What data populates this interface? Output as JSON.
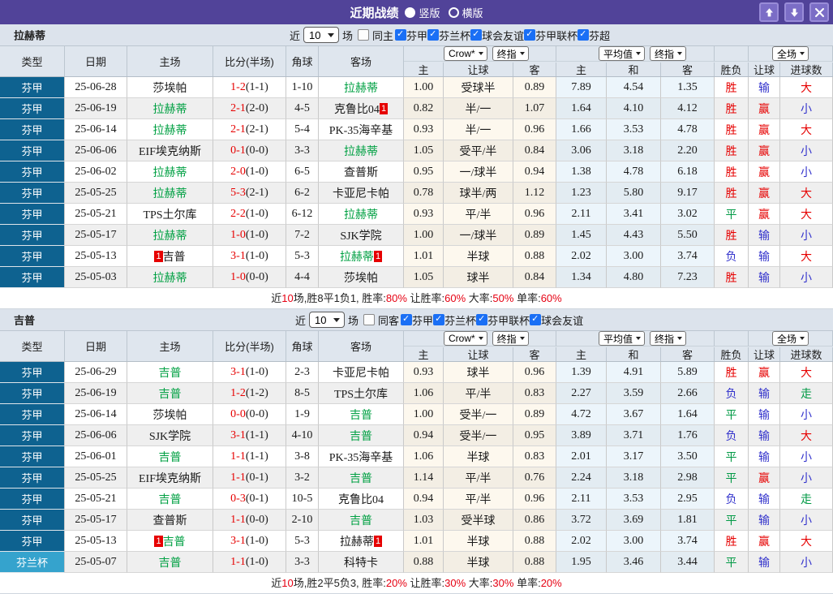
{
  "titlebar": {
    "title": "近期战绩",
    "radios": [
      {
        "label": "竖版",
        "selected": true
      },
      {
        "label": "横版",
        "selected": false
      }
    ],
    "buttons": [
      {
        "name": "scroll-up-button",
        "icon": "arrow-up-icon"
      },
      {
        "name": "scroll-down-button",
        "icon": "arrow-down-icon"
      },
      {
        "name": "close-button",
        "icon": "close-icon"
      }
    ],
    "colors": {
      "bar": "#514399",
      "button": "#7b6dc6"
    }
  },
  "table_header": {
    "static_cols": [
      "类型",
      "日期",
      "主场",
      "比分(半场)",
      "角球",
      "客场"
    ],
    "groups": [
      {
        "selects": [
          "Crow*",
          "终指"
        ]
      },
      {
        "selects": [
          "平均值",
          "终指"
        ]
      },
      {
        "selects": [
          "全场"
        ]
      }
    ],
    "sub_cols": [
      "主",
      "让球",
      "客",
      "主",
      "和",
      "客",
      "胜负",
      "让球",
      "进球数"
    ]
  },
  "colors": {
    "league_cell": "#0e6290",
    "cup_cell": "#35a3cd",
    "focus_team": "#00a043",
    "score_red": "#e60000",
    "win_red": "#e60000",
    "lose_blue": "#3333cc",
    "draw_green": "#009944"
  },
  "sections": [
    {
      "team": "拉赫蒂",
      "filter": {
        "near": "近",
        "count": "10",
        "games": "场",
        "same": {
          "label": "同主",
          "checked": false
        },
        "leagues": [
          {
            "label": "芬甲",
            "checked": true
          },
          {
            "label": "芬兰杯",
            "checked": true
          },
          {
            "label": "球会友谊",
            "checked": true
          },
          {
            "label": "芬甲联杯",
            "checked": true
          },
          {
            "label": "芬超",
            "checked": true
          }
        ]
      },
      "rows": [
        {
          "league": "芬甲",
          "cup": false,
          "date": "25-06-28",
          "home": {
            "name": "莎埃帕",
            "focus": false
          },
          "score": "1-2",
          "half": "(1-1)",
          "corners": "1-10",
          "away": {
            "name": "拉赫蒂",
            "focus": true
          },
          "ah": [
            "1.00",
            "受球半",
            "0.89"
          ],
          "eu": [
            "7.89",
            "4.54",
            "1.35"
          ],
          "outcome": {
            "text": "胜",
            "c": "red"
          },
          "handicap": {
            "text": "输",
            "c": "blue"
          },
          "goals": {
            "text": "大",
            "c": "red"
          }
        },
        {
          "league": "芬甲",
          "cup": false,
          "date": "25-06-19",
          "home": {
            "name": "拉赫蒂",
            "focus": true
          },
          "score": "2-1",
          "half": "(2-0)",
          "corners": "4-5",
          "away": {
            "name": "克鲁比04",
            "focus": false,
            "badge": "1",
            "badge_pos": "after"
          },
          "ah": [
            "0.82",
            "半/一",
            "1.07"
          ],
          "eu": [
            "1.64",
            "4.10",
            "4.12"
          ],
          "outcome": {
            "text": "胜",
            "c": "red"
          },
          "handicap": {
            "text": "赢",
            "c": "red"
          },
          "goals": {
            "text": "小",
            "c": "blue"
          }
        },
        {
          "league": "芬甲",
          "cup": false,
          "date": "25-06-14",
          "home": {
            "name": "拉赫蒂",
            "focus": true
          },
          "score": "2-1",
          "half": "(2-1)",
          "corners": "5-4",
          "away": {
            "name": "PK-35海辛基",
            "focus": false
          },
          "ah": [
            "0.93",
            "半/一",
            "0.96"
          ],
          "eu": [
            "1.66",
            "3.53",
            "4.78"
          ],
          "outcome": {
            "text": "胜",
            "c": "red"
          },
          "handicap": {
            "text": "赢",
            "c": "red"
          },
          "goals": {
            "text": "大",
            "c": "red"
          }
        },
        {
          "league": "芬甲",
          "cup": false,
          "date": "25-06-06",
          "home": {
            "name": "EIF埃克纳斯",
            "focus": false
          },
          "score": "0-1",
          "half": "(0-0)",
          "corners": "3-3",
          "away": {
            "name": "拉赫蒂",
            "focus": true
          },
          "ah": [
            "1.05",
            "受平/半",
            "0.84"
          ],
          "eu": [
            "3.06",
            "3.18",
            "2.20"
          ],
          "outcome": {
            "text": "胜",
            "c": "red"
          },
          "handicap": {
            "text": "赢",
            "c": "red"
          },
          "goals": {
            "text": "小",
            "c": "blue"
          }
        },
        {
          "league": "芬甲",
          "cup": false,
          "date": "25-06-02",
          "home": {
            "name": "拉赫蒂",
            "focus": true
          },
          "score": "2-0",
          "half": "(1-0)",
          "corners": "6-5",
          "away": {
            "name": "查普斯",
            "focus": false
          },
          "ah": [
            "0.95",
            "一/球半",
            "0.94"
          ],
          "eu": [
            "1.38",
            "4.78",
            "6.18"
          ],
          "outcome": {
            "text": "胜",
            "c": "red"
          },
          "handicap": {
            "text": "赢",
            "c": "red"
          },
          "goals": {
            "text": "小",
            "c": "blue"
          }
        },
        {
          "league": "芬甲",
          "cup": false,
          "date": "25-05-25",
          "home": {
            "name": "拉赫蒂",
            "focus": true
          },
          "score": "5-3",
          "half": "(2-1)",
          "corners": "6-2",
          "away": {
            "name": "卡亚尼卡帕",
            "focus": false
          },
          "ah": [
            "0.78",
            "球半/两",
            "1.12"
          ],
          "eu": [
            "1.23",
            "5.80",
            "9.17"
          ],
          "outcome": {
            "text": "胜",
            "c": "red"
          },
          "handicap": {
            "text": "赢",
            "c": "red"
          },
          "goals": {
            "text": "大",
            "c": "red"
          }
        },
        {
          "league": "芬甲",
          "cup": false,
          "date": "25-05-21",
          "home": {
            "name": "TPS土尔库",
            "focus": false
          },
          "score": "2-2",
          "half": "(1-0)",
          "corners": "6-12",
          "away": {
            "name": "拉赫蒂",
            "focus": true
          },
          "ah": [
            "0.93",
            "平/半",
            "0.96"
          ],
          "eu": [
            "2.11",
            "3.41",
            "3.02"
          ],
          "outcome": {
            "text": "平",
            "c": "green"
          },
          "handicap": {
            "text": "赢",
            "c": "red"
          },
          "goals": {
            "text": "大",
            "c": "red"
          }
        },
        {
          "league": "芬甲",
          "cup": false,
          "date": "25-05-17",
          "home": {
            "name": "拉赫蒂",
            "focus": true
          },
          "score": "1-0",
          "half": "(1-0)",
          "corners": "7-2",
          "away": {
            "name": "SJK学院",
            "focus": false
          },
          "ah": [
            "1.00",
            "一/球半",
            "0.89"
          ],
          "eu": [
            "1.45",
            "4.43",
            "5.50"
          ],
          "outcome": {
            "text": "胜",
            "c": "red"
          },
          "handicap": {
            "text": "输",
            "c": "blue"
          },
          "goals": {
            "text": "小",
            "c": "blue"
          }
        },
        {
          "league": "芬甲",
          "cup": false,
          "date": "25-05-13",
          "home": {
            "name": "吉普",
            "focus": false,
            "badge": "1",
            "badge_pos": "before"
          },
          "score": "3-1",
          "half": "(1-0)",
          "corners": "5-3",
          "away": {
            "name": "拉赫蒂",
            "focus": true,
            "badge": "1",
            "badge_pos": "after"
          },
          "ah": [
            "1.01",
            "半球",
            "0.88"
          ],
          "eu": [
            "2.02",
            "3.00",
            "3.74"
          ],
          "outcome": {
            "text": "负",
            "c": "blue"
          },
          "handicap": {
            "text": "输",
            "c": "blue"
          },
          "goals": {
            "text": "大",
            "c": "red"
          }
        },
        {
          "league": "芬甲",
          "cup": false,
          "date": "25-05-03",
          "home": {
            "name": "拉赫蒂",
            "focus": true
          },
          "score": "1-0",
          "half": "(0-0)",
          "corners": "4-4",
          "away": {
            "name": "莎埃帕",
            "focus": false
          },
          "ah": [
            "1.05",
            "球半",
            "0.84"
          ],
          "eu": [
            "1.34",
            "4.80",
            "7.23"
          ],
          "outcome": {
            "text": "胜",
            "c": "red"
          },
          "handicap": {
            "text": "输",
            "c": "blue"
          },
          "goals": {
            "text": "小",
            "c": "blue"
          }
        }
      ],
      "summary": [
        {
          "t": "近"
        },
        {
          "t": "10",
          "red": true
        },
        {
          "t": "场,胜8平1负1, 胜率:"
        },
        {
          "t": "80%",
          "red": true
        },
        {
          "t": " 让胜率:"
        },
        {
          "t": "60%",
          "red": true
        },
        {
          "t": " 大率:"
        },
        {
          "t": "50%",
          "red": true
        },
        {
          "t": " 单率:"
        },
        {
          "t": "60%",
          "red": true
        }
      ]
    },
    {
      "team": "吉普",
      "filter": {
        "near": "近",
        "count": "10",
        "games": "场",
        "same": {
          "label": "同客",
          "checked": false
        },
        "leagues": [
          {
            "label": "芬甲",
            "checked": true
          },
          {
            "label": "芬兰杯",
            "checked": true
          },
          {
            "label": "芬甲联杯",
            "checked": true
          },
          {
            "label": "球会友谊",
            "checked": true
          }
        ]
      },
      "rows": [
        {
          "league": "芬甲",
          "cup": false,
          "date": "25-06-29",
          "home": {
            "name": "吉普",
            "focus": true
          },
          "score": "3-1",
          "half": "(1-0)",
          "corners": "2-3",
          "away": {
            "name": "卡亚尼卡帕",
            "focus": false
          },
          "ah": [
            "0.93",
            "球半",
            "0.96"
          ],
          "eu": [
            "1.39",
            "4.91",
            "5.89"
          ],
          "outcome": {
            "text": "胜",
            "c": "red"
          },
          "handicap": {
            "text": "赢",
            "c": "red"
          },
          "goals": {
            "text": "大",
            "c": "red"
          }
        },
        {
          "league": "芬甲",
          "cup": false,
          "date": "25-06-19",
          "home": {
            "name": "吉普",
            "focus": true
          },
          "score": "1-2",
          "half": "(1-2)",
          "corners": "8-5",
          "away": {
            "name": "TPS土尔库",
            "focus": false
          },
          "ah": [
            "1.06",
            "平/半",
            "0.83"
          ],
          "eu": [
            "2.27",
            "3.59",
            "2.66"
          ],
          "outcome": {
            "text": "负",
            "c": "blue"
          },
          "handicap": {
            "text": "输",
            "c": "blue"
          },
          "goals": {
            "text": "走",
            "c": "green"
          }
        },
        {
          "league": "芬甲",
          "cup": false,
          "date": "25-06-14",
          "home": {
            "name": "莎埃帕",
            "focus": false
          },
          "score": "0-0",
          "half": "(0-0)",
          "corners": "1-9",
          "away": {
            "name": "吉普",
            "focus": true
          },
          "ah": [
            "1.00",
            "受半/一",
            "0.89"
          ],
          "eu": [
            "4.72",
            "3.67",
            "1.64"
          ],
          "outcome": {
            "text": "平",
            "c": "green"
          },
          "handicap": {
            "text": "输",
            "c": "blue"
          },
          "goals": {
            "text": "小",
            "c": "blue"
          }
        },
        {
          "league": "芬甲",
          "cup": false,
          "date": "25-06-06",
          "home": {
            "name": "SJK学院",
            "focus": false
          },
          "score": "3-1",
          "half": "(1-1)",
          "corners": "4-10",
          "away": {
            "name": "吉普",
            "focus": true
          },
          "ah": [
            "0.94",
            "受半/一",
            "0.95"
          ],
          "eu": [
            "3.89",
            "3.71",
            "1.76"
          ],
          "outcome": {
            "text": "负",
            "c": "blue"
          },
          "handicap": {
            "text": "输",
            "c": "blue"
          },
          "goals": {
            "text": "大",
            "c": "red"
          }
        },
        {
          "league": "芬甲",
          "cup": false,
          "date": "25-06-01",
          "home": {
            "name": "吉普",
            "focus": true
          },
          "score": "1-1",
          "half": "(1-1)",
          "corners": "3-8",
          "away": {
            "name": "PK-35海辛基",
            "focus": false
          },
          "ah": [
            "1.06",
            "半球",
            "0.83"
          ],
          "eu": [
            "2.01",
            "3.17",
            "3.50"
          ],
          "outcome": {
            "text": "平",
            "c": "green"
          },
          "handicap": {
            "text": "输",
            "c": "blue"
          },
          "goals": {
            "text": "小",
            "c": "blue"
          }
        },
        {
          "league": "芬甲",
          "cup": false,
          "date": "25-05-25",
          "home": {
            "name": "EIF埃克纳斯",
            "focus": false
          },
          "score": "1-1",
          "half": "(0-1)",
          "corners": "3-2",
          "away": {
            "name": "吉普",
            "focus": true
          },
          "ah": [
            "1.14",
            "平/半",
            "0.76"
          ],
          "eu": [
            "2.24",
            "3.18",
            "2.98"
          ],
          "outcome": {
            "text": "平",
            "c": "green"
          },
          "handicap": {
            "text": "赢",
            "c": "red"
          },
          "goals": {
            "text": "小",
            "c": "blue"
          }
        },
        {
          "league": "芬甲",
          "cup": false,
          "date": "25-05-21",
          "home": {
            "name": "吉普",
            "focus": true
          },
          "score": "0-3",
          "half": "(0-1)",
          "corners": "10-5",
          "away": {
            "name": "克鲁比04",
            "focus": false
          },
          "ah": [
            "0.94",
            "平/半",
            "0.96"
          ],
          "eu": [
            "2.11",
            "3.53",
            "2.95"
          ],
          "outcome": {
            "text": "负",
            "c": "blue"
          },
          "handicap": {
            "text": "输",
            "c": "blue"
          },
          "goals": {
            "text": "走",
            "c": "green"
          }
        },
        {
          "league": "芬甲",
          "cup": false,
          "date": "25-05-17",
          "home": {
            "name": "查普斯",
            "focus": false
          },
          "score": "1-1",
          "half": "(0-0)",
          "corners": "2-10",
          "away": {
            "name": "吉普",
            "focus": true
          },
          "ah": [
            "1.03",
            "受半球",
            "0.86"
          ],
          "eu": [
            "3.72",
            "3.69",
            "1.81"
          ],
          "outcome": {
            "text": "平",
            "c": "green"
          },
          "handicap": {
            "text": "输",
            "c": "blue"
          },
          "goals": {
            "text": "小",
            "c": "blue"
          }
        },
        {
          "league": "芬甲",
          "cup": false,
          "date": "25-05-13",
          "home": {
            "name": "吉普",
            "focus": true,
            "badge": "1",
            "badge_pos": "before"
          },
          "score": "3-1",
          "half": "(1-0)",
          "corners": "5-3",
          "away": {
            "name": "拉赫蒂",
            "focus": false,
            "badge": "1",
            "badge_pos": "after"
          },
          "ah": [
            "1.01",
            "半球",
            "0.88"
          ],
          "eu": [
            "2.02",
            "3.00",
            "3.74"
          ],
          "outcome": {
            "text": "胜",
            "c": "red"
          },
          "handicap": {
            "text": "赢",
            "c": "red"
          },
          "goals": {
            "text": "大",
            "c": "red"
          }
        },
        {
          "league": "芬兰杯",
          "cup": true,
          "date": "25-05-07",
          "home": {
            "name": "吉普",
            "focus": true
          },
          "score": "1-1",
          "half": "(1-0)",
          "corners": "3-3",
          "away": {
            "name": "科特卡",
            "focus": false
          },
          "ah": [
            "0.88",
            "半球",
            "0.88"
          ],
          "eu": [
            "1.95",
            "3.46",
            "3.44"
          ],
          "outcome": {
            "text": "平",
            "c": "green"
          },
          "handicap": {
            "text": "输",
            "c": "blue"
          },
          "goals": {
            "text": "小",
            "c": "blue"
          }
        }
      ],
      "summary": [
        {
          "t": "近"
        },
        {
          "t": "10",
          "red": true
        },
        {
          "t": "场,胜2平5负3, 胜率:"
        },
        {
          "t": "20%",
          "red": true
        },
        {
          "t": " 让胜率:"
        },
        {
          "t": "30%",
          "red": true
        },
        {
          "t": " 大率:"
        },
        {
          "t": "30%",
          "red": true
        },
        {
          "t": " 单率:"
        },
        {
          "t": "20%",
          "red": true
        }
      ]
    }
  ]
}
